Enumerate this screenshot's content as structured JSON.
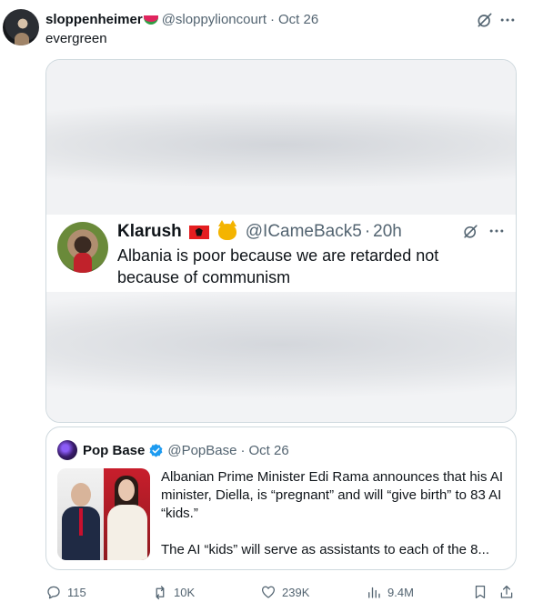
{
  "post": {
    "author_name": "sloppenheimer",
    "author_emoji": "watermelon-emoji",
    "handle": "@sloppylioncourt",
    "separator": "·",
    "date": "Oct 26",
    "text": "evergreen"
  },
  "media": {
    "inner_tweet": {
      "name": "Klarush",
      "badges": [
        "albania-flag-emoji",
        "smiling-cat-emoji"
      ],
      "handle": "@ICameBack5",
      "separator": "·",
      "time": "20h",
      "text": "Albania is poor because we are retarded not because of communism"
    }
  },
  "quote": {
    "name": "Pop Base",
    "verified": true,
    "handle": "@PopBase",
    "separator": "·",
    "date": "Oct 26",
    "paragraph1": "Albanian Prime Minister Edi Rama announces that his AI minister, Diella, is “pregnant” and will “give birth” to 83 AI “kids.”",
    "paragraph2": "The AI “kids” will serve as assistants to each of the 8..."
  },
  "actions": {
    "replies": "115",
    "reposts": "10K",
    "likes": "239K",
    "views": "9.4M"
  },
  "colors": {
    "text_primary": "#0f1419",
    "text_secondary": "#536471",
    "border": "#cfd9de",
    "verified_blue": "#1d9bf0"
  }
}
